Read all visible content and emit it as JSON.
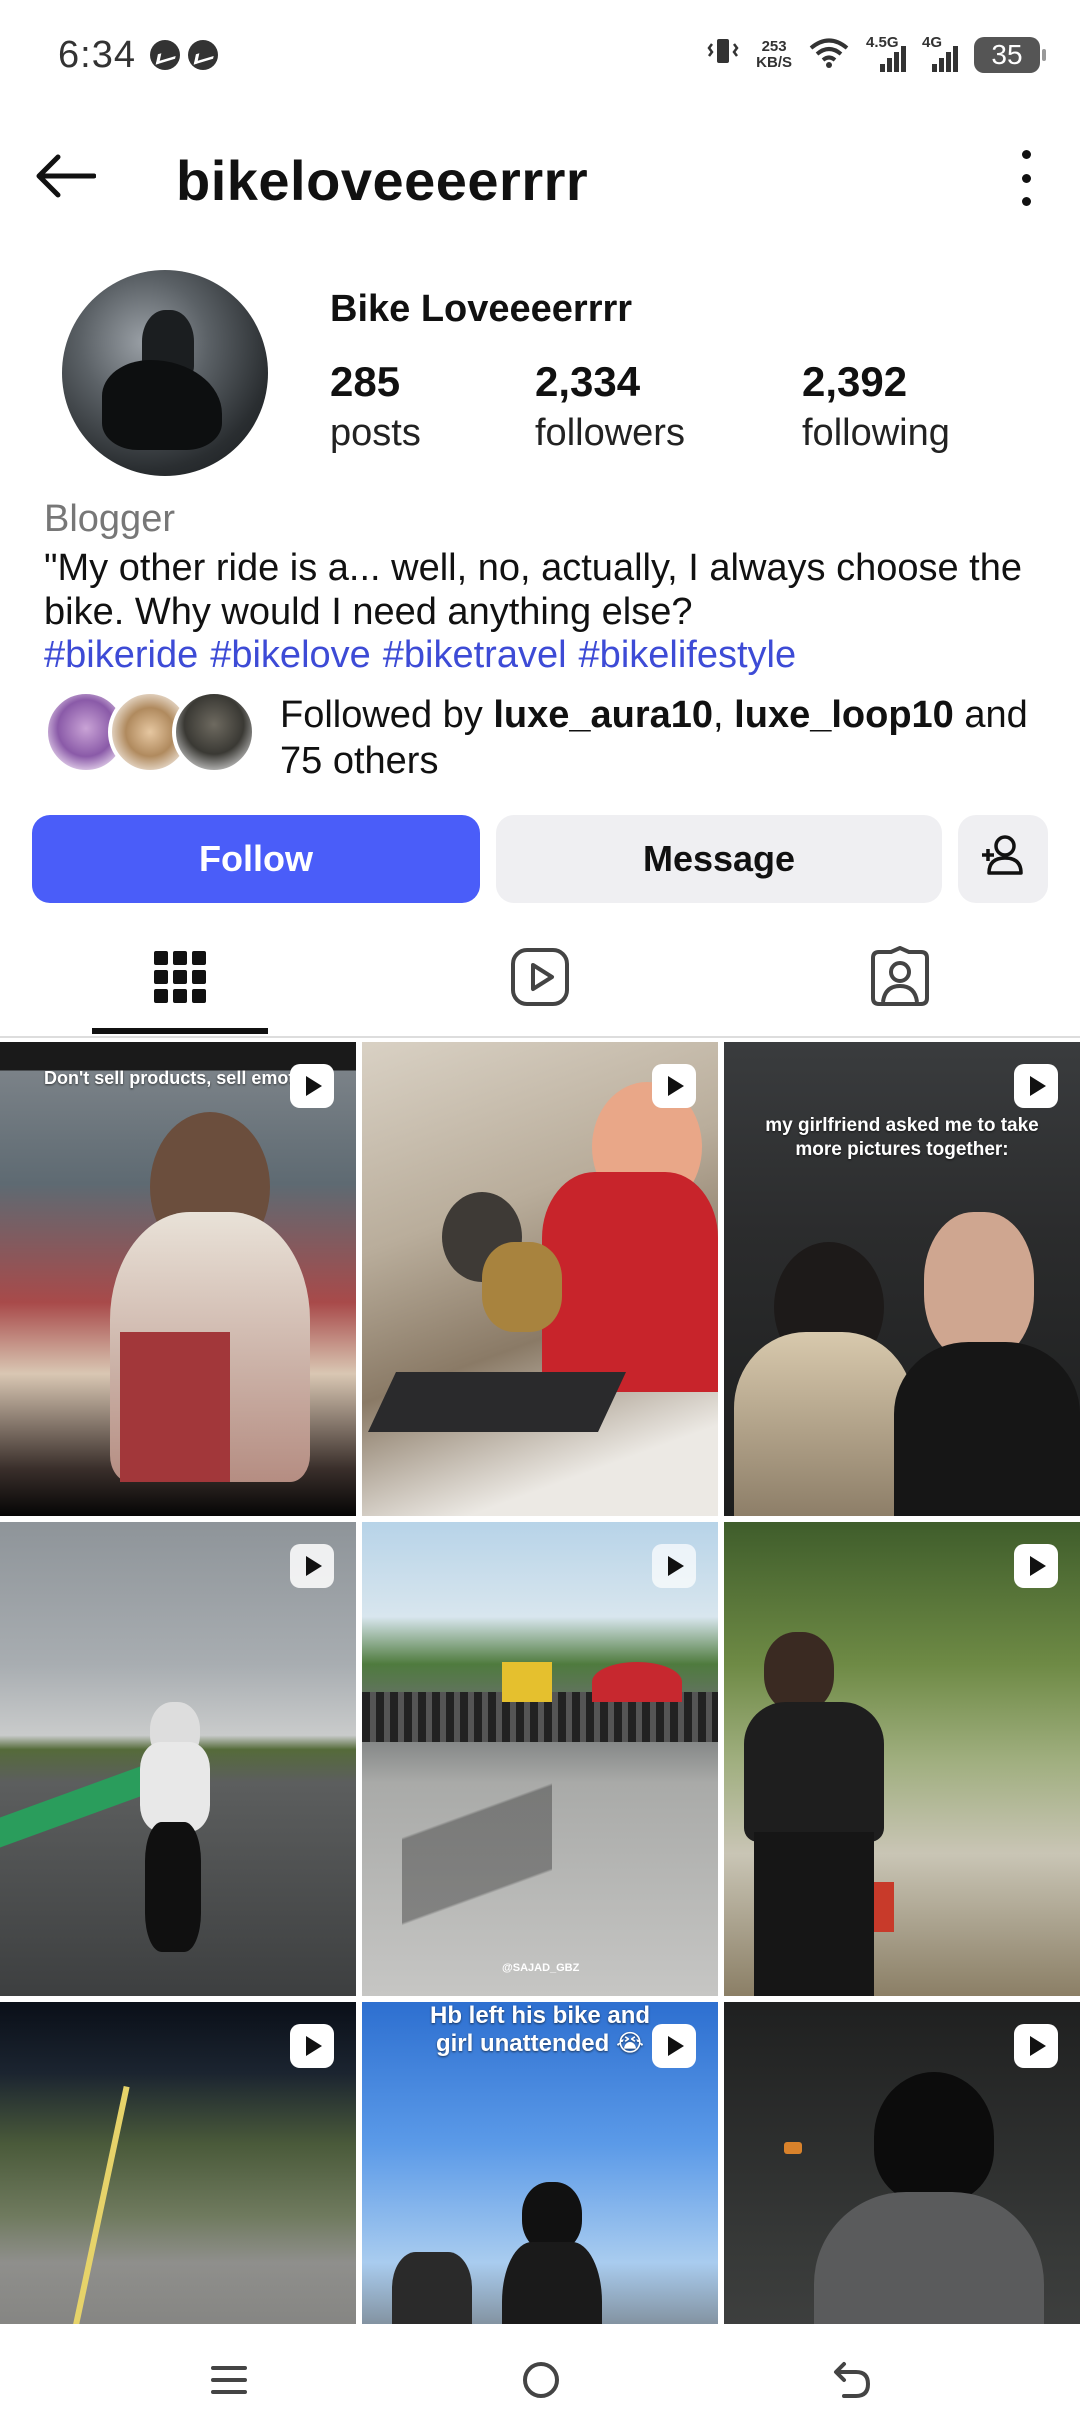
{
  "status_bar": {
    "time": "6:34",
    "speed_value": "253",
    "speed_unit": "KB/S",
    "net1": "4.5G",
    "net2": "4G",
    "battery": "35"
  },
  "header": {
    "username": "bikeloveeeerrrr"
  },
  "profile": {
    "display_name": "Bike Loveeeerrrr",
    "stats": [
      {
        "value": "285",
        "label": "posts"
      },
      {
        "value": "2,334",
        "label": "followers"
      },
      {
        "value": "2,392",
        "label": "following"
      }
    ],
    "category": "Blogger",
    "bio": "\"My other ride is a... well, no, actually, I always choose the bike. Why would I need anything else?",
    "hashtags": [
      "#bikeride",
      "#bikelove",
      "#biketravel",
      "#bikelifestyle"
    ],
    "followed_by": {
      "prefix": "Followed by ",
      "user1": "luxe_aura10",
      "sep": ", ",
      "user2": "luxe_loop10",
      "suffix": " and 75 others"
    }
  },
  "buttons": {
    "follow": "Follow",
    "message": "Message"
  },
  "posts": [
    {
      "caption": "Don't sell products, sell emotio",
      "reel": true
    },
    {
      "caption": "",
      "reel": true
    },
    {
      "caption": "my girlfriend asked me to take more pictures together:",
      "reel": true
    },
    {
      "caption": "",
      "reel": true
    },
    {
      "caption": "",
      "reel": true,
      "watermark": "@SAJAD_GBZ"
    },
    {
      "caption": "",
      "reel": true
    },
    {
      "caption": "",
      "reel": true
    },
    {
      "caption": "Hb left his bike and girl unattended 😭",
      "reel": true
    },
    {
      "caption": "",
      "reel": true
    }
  ],
  "colors": {
    "accent": "#4a5df9",
    "hashtag": "#3d4bd6",
    "button_secondary": "#efeff2"
  }
}
